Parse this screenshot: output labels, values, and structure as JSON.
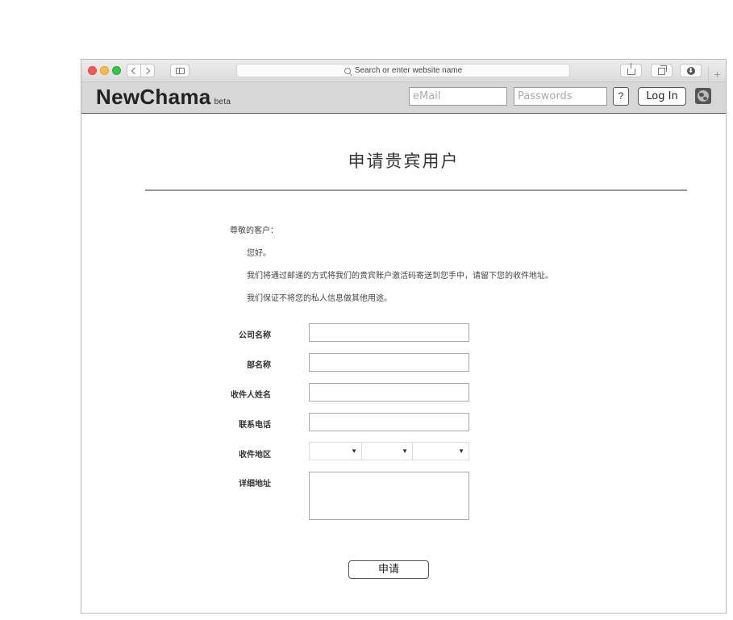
{
  "browser": {
    "address_placeholder": "Search or enter website name",
    "new_tab_label": "+"
  },
  "site": {
    "brand": "NewChama",
    "beta": "beta",
    "email_placeholder": "eMail",
    "password_placeholder": "Passwords",
    "help_label": "?",
    "login_label": "Log In"
  },
  "page": {
    "title": "申请贵宾用户",
    "greeting": "尊敬的客户：",
    "hello": "您好。",
    "line1": "我们将通过邮递的方式将我们的贵宾账户激活码寄送到您手中，请留下您的收件地址。",
    "line2": "我们保证不将您的私人信息做其他用途。"
  },
  "form": {
    "company_label": "公司名称",
    "department_label": "部名称",
    "recipient_label": "收件人姓名",
    "phone_label": "联系电话",
    "region_label": "收件地区",
    "address_label": "详细地址",
    "submit_label": "申请"
  }
}
